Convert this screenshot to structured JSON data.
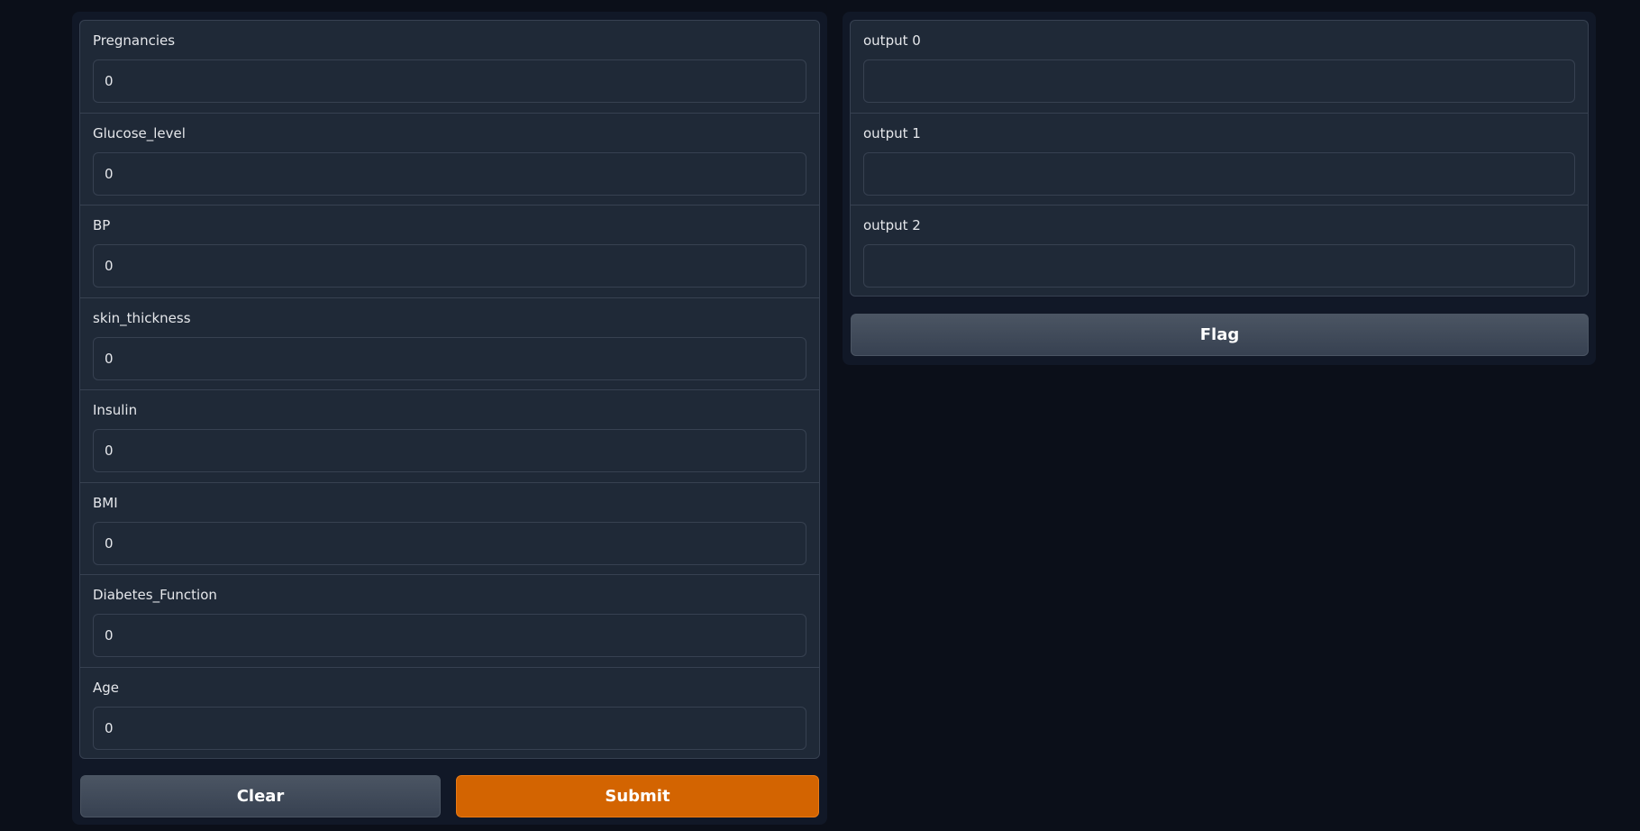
{
  "inputs": [
    {
      "label": "Pregnancies",
      "value": "0"
    },
    {
      "label": "Glucose_level",
      "value": "0"
    },
    {
      "label": "BP",
      "value": "0"
    },
    {
      "label": "skin_thickness",
      "value": "0"
    },
    {
      "label": "Insulin",
      "value": "0"
    },
    {
      "label": "BMI",
      "value": "0"
    },
    {
      "label": "Diabetes_Function",
      "value": "0"
    },
    {
      "label": "Age",
      "value": "0"
    }
  ],
  "outputs": [
    {
      "label": "output 0",
      "value": ""
    },
    {
      "label": "output 1",
      "value": ""
    },
    {
      "label": "output 2",
      "value": ""
    }
  ],
  "buttons": {
    "clear_label": "Clear",
    "submit_label": "Submit",
    "flag_label": "Flag"
  },
  "colors": {
    "background": "#0b0f19",
    "panel": "#1f2937",
    "submit": "#d36401"
  }
}
